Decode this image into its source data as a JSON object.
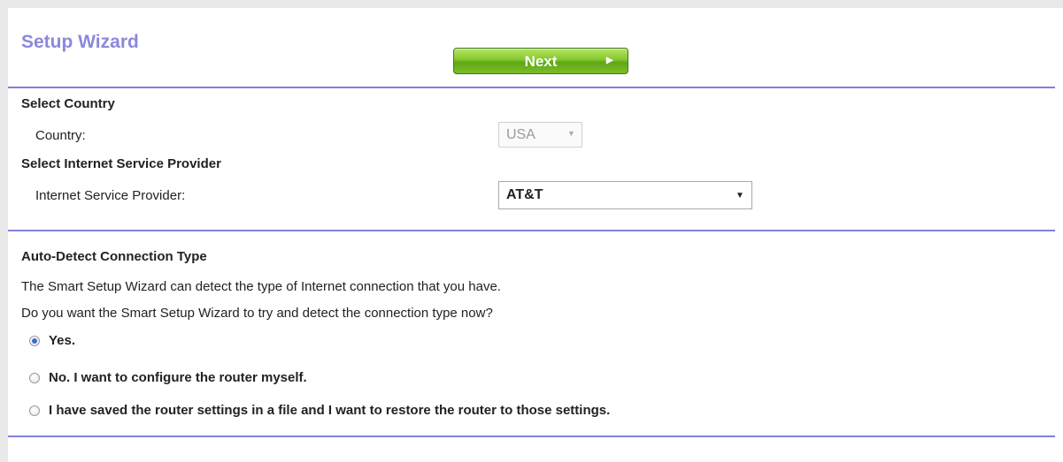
{
  "header": {
    "title": "Setup Wizard",
    "next_label": "Next"
  },
  "country": {
    "heading": "Select Country",
    "label": "Country:",
    "value": "USA"
  },
  "isp": {
    "heading": "Select Internet Service Provider",
    "label": "Internet Service Provider:",
    "value": "AT&T"
  },
  "autodetect": {
    "heading": "Auto-Detect Connection Type",
    "line1": "The Smart Setup Wizard can detect the type of Internet connection that you have.",
    "line2": "Do you want the Smart Setup Wizard to try and detect the connection type now?",
    "options": [
      {
        "label": "Yes.",
        "selected": true
      },
      {
        "label": "No. I want to configure the router myself.",
        "selected": false
      },
      {
        "label": "I have saved the router settings in a file and I want to restore the router to those settings.",
        "selected": false
      }
    ]
  },
  "colors": {
    "title": "#8b88dd",
    "divider": "#8080e0",
    "button": "#6fb41f",
    "background": "#e9e9e9"
  }
}
